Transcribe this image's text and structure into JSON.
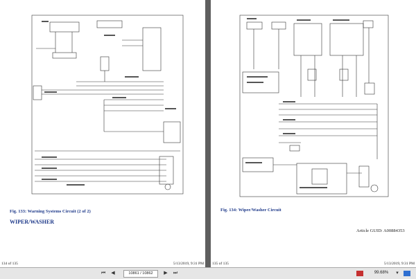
{
  "left_page": {
    "caption": "Fig. 133: Warning Systems Circuit (2 of 2)",
    "section_title": "WIPER/WASHER",
    "footer_left": "134 of 135",
    "footer_right": "5/13/2019, 9:31 PM"
  },
  "right_page": {
    "caption": "Fig. 134: Wiper/Washer Circuit",
    "article_guid": "Article GUID: A00884353",
    "footer_left": "135 of 135",
    "footer_right": "5/13/2019, 9:31 PM"
  },
  "toolbar": {
    "first_icon": "first-page-icon",
    "prev_icon": "previous-page-icon",
    "page_value": "10861 / 10862",
    "next_icon": "next-page-icon",
    "last_icon": "last-page-icon",
    "zoom_value": "99.68%",
    "accent": "#c53030"
  }
}
